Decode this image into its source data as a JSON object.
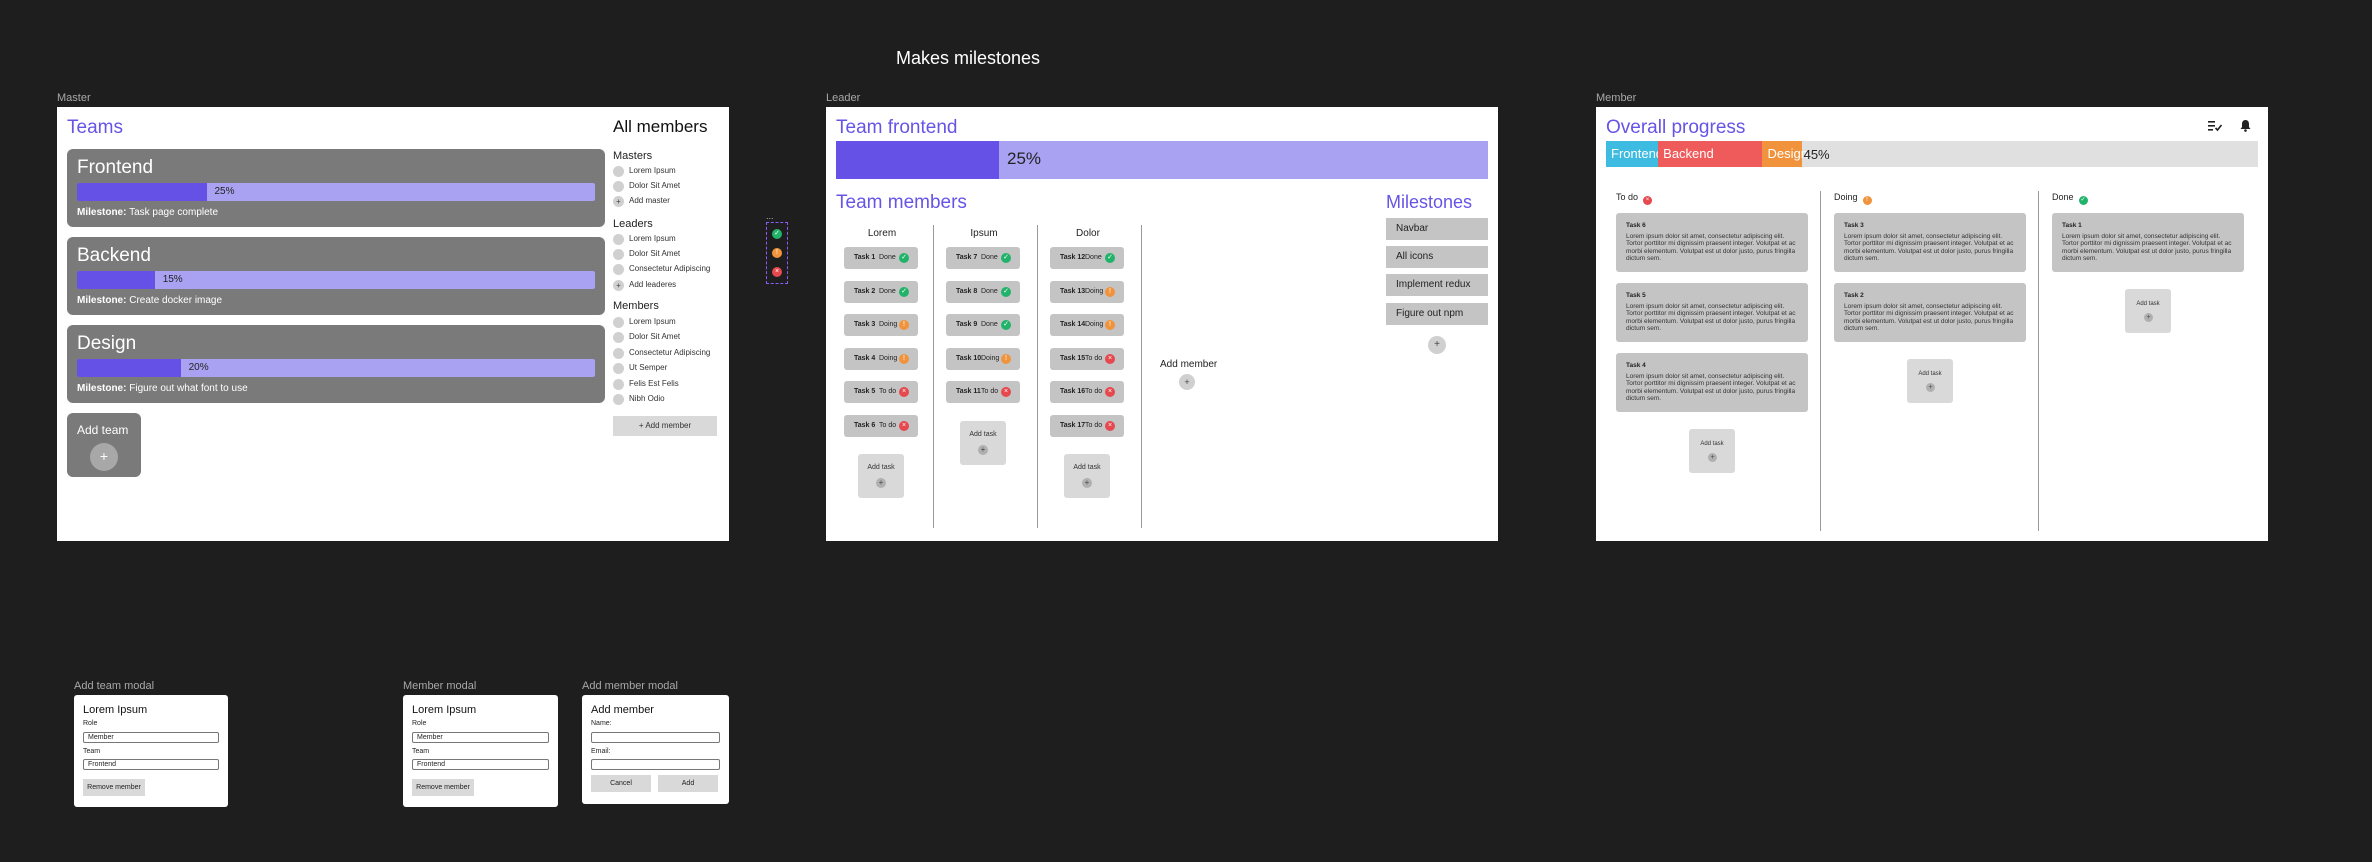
{
  "page_title": "Makes milestones",
  "colors": {
    "canvas": "#1e1e1e",
    "accent": "#6551e6",
    "accent_light": "#a9a2f2",
    "heading": "#6654e6",
    "done": "#22b36b",
    "doing": "#f0933c",
    "todo": "#e5484d",
    "frontend": "#3dbbe0",
    "backend": "#ef5a5a",
    "design": "#f0933c"
  },
  "master": {
    "frame_label": "Master",
    "title": "Teams",
    "teams": [
      {
        "name": "Frontend",
        "progress": 0.25,
        "progress_label": "25%",
        "milestone_label": "Milestone:",
        "milestone": "Task page complete"
      },
      {
        "name": "Backend",
        "progress": 0.15,
        "progress_label": "15%",
        "milestone_label": "Milestone:",
        "milestone": "Create docker image"
      },
      {
        "name": "Design",
        "progress": 0.2,
        "progress_label": "20%",
        "milestone_label": "Milestone:",
        "milestone": "Figure out what font to use"
      }
    ],
    "add_team_label": "Add team",
    "add_team_icon": "+",
    "members_title": "All members",
    "masters_heading": "Masters",
    "masters": [
      "Lorem Ipsum",
      "Dolor Sit Amet"
    ],
    "add_master": "Add master",
    "leaders_heading": "Leaders",
    "leaders": [
      "Lorem Ipsum",
      "Dolor Sit Amet",
      "Consectetur Adipiscing"
    ],
    "add_leaders": "Add leaderes",
    "members_heading": "Members",
    "members": [
      "Lorem Ipsum",
      "Dolor Sit Amet",
      "Consectetur Adipiscing",
      "Ut Semper",
      "Felis Est Felis",
      "Nibh Odio"
    ],
    "add_member_button": "+ Add member",
    "plus": "+"
  },
  "legend": {
    "dots": "...",
    "statuses": [
      {
        "name": "done",
        "glyph": "✓"
      },
      {
        "name": "doing",
        "glyph": "!"
      },
      {
        "name": "todo",
        "glyph": "×"
      }
    ]
  },
  "leader": {
    "frame_label": "Leader",
    "title": "Team frontend",
    "progress": 0.25,
    "progress_label": "25%",
    "members_title": "Team members",
    "columns": [
      {
        "name": "Lorem",
        "tasks": [
          {
            "name": "Task 1",
            "status": "Done",
            "kind": "done"
          },
          {
            "name": "Task 2",
            "status": "Done",
            "kind": "done"
          },
          {
            "name": "Task 3",
            "status": "Doing",
            "kind": "doing"
          },
          {
            "name": "Task 4",
            "status": "Doing",
            "kind": "doing"
          },
          {
            "name": "Task 5",
            "status": "To do",
            "kind": "todo"
          },
          {
            "name": "Task 6",
            "status": "To do",
            "kind": "todo"
          }
        ]
      },
      {
        "name": "Ipsum",
        "tasks": [
          {
            "name": "Task 7",
            "status": "Done",
            "kind": "done"
          },
          {
            "name": "Task 8",
            "status": "Done",
            "kind": "done"
          },
          {
            "name": "Task 9",
            "status": "Done",
            "kind": "done"
          },
          {
            "name": "Task 10",
            "status": "Doing",
            "kind": "doing"
          },
          {
            "name": "Task 11",
            "status": "To do",
            "kind": "todo"
          }
        ]
      },
      {
        "name": "Dolor",
        "tasks": [
          {
            "name": "Task 12",
            "status": "Done",
            "kind": "done"
          },
          {
            "name": "Task 13",
            "status": "Doing",
            "kind": "doing"
          },
          {
            "name": "Task 14",
            "status": "Doing",
            "kind": "doing"
          },
          {
            "name": "Task 15",
            "status": "To do",
            "kind": "todo"
          },
          {
            "name": "Task 16",
            "status": "To do",
            "kind": "todo"
          },
          {
            "name": "Task 17",
            "status": "To do",
            "kind": "todo"
          }
        ]
      }
    ],
    "add_task_label": "Add task",
    "add_member_label": "Add member",
    "milestones_title": "Milestones",
    "milestones": [
      "Navbar",
      "All icons",
      "Implement redux",
      "Figure out npm"
    ],
    "plus": "+"
  },
  "member": {
    "frame_label": "Member",
    "title": "Overall progress",
    "segments": [
      {
        "name": "Frontend",
        "share": 0.08
      },
      {
        "name": "Backend",
        "share": 0.16
      },
      {
        "name": "Design",
        "share": 0.06
      }
    ],
    "overall_label": "45%",
    "icons": [
      "task-list-icon",
      "bell-icon"
    ],
    "columns": [
      {
        "name": "To do",
        "kind": "todo",
        "cards": [
          {
            "title": "Task 6",
            "body": "Lorem ipsum dolor sit amet, consectetur adipiscing elit. Tortor porttitor mi dignissim praesent integer. Volutpat et ac morbi elementum. Volutpat est ut dolor justo, purus fringilla dictum sem."
          },
          {
            "title": "Task 5",
            "body": "Lorem ipsum dolor sit amet, consectetur adipiscing elit. Tortor porttitor mi dignissim praesent integer. Volutpat et ac morbi elementum. Volutpat est ut dolor justo, purus fringilla dictum sem."
          },
          {
            "title": "Task 4",
            "body": "Lorem ipsum dolor sit amet, consectetur adipiscing elit. Tortor porttitor mi dignissim praesent integer. Volutpat et ac morbi elementum. Volutpat est ut dolor justo, purus fringilla dictum sem."
          }
        ]
      },
      {
        "name": "Doing",
        "kind": "doing",
        "cards": [
          {
            "title": "Task 3",
            "body": "Lorem ipsum dolor sit amet, consectetur adipiscing elit. Tortor porttitor mi dignissim praesent integer. Volutpat et ac morbi elementum. Volutpat est ut dolor justo, purus fringilla dictum sem."
          },
          {
            "title": "Task 2",
            "body": "Lorem ipsum dolor sit amet, consectetur adipiscing elit. Tortor porttitor mi dignissim praesent integer. Volutpat et ac morbi elementum. Volutpat est ut dolor justo, purus fringilla dictum sem."
          }
        ]
      },
      {
        "name": "Done",
        "kind": "done",
        "cards": [
          {
            "title": "Task 1",
            "body": "Lorem ipsum dolor sit amet, consectetur adipiscing elit. Tortor porttitor mi dignissim praesent integer. Volutpat et ac morbi elementum. Volutpat est ut dolor justo, purus fringilla dictum sem."
          }
        ]
      }
    ],
    "add_task_label": "Add task",
    "plus": "+"
  },
  "modals": {
    "add_team": {
      "frame_label": "Add team modal",
      "title": "Lorem Ipsum",
      "role_label": "Role",
      "role_value": "Member",
      "team_label": "Team",
      "team_value": "Frontend",
      "remove_button": "Remove member"
    },
    "member": {
      "frame_label": "Member modal",
      "title": "Lorem Ipsum",
      "role_label": "Role",
      "role_value": "Member",
      "team_label": "Team",
      "team_value": "Frontend",
      "remove_button": "Remove member"
    },
    "add_member": {
      "frame_label": "Add member modal",
      "title": "Add member",
      "name_label": "Name:",
      "email_label": "Email:",
      "cancel_button": "Cancel",
      "add_button": "Add"
    }
  }
}
